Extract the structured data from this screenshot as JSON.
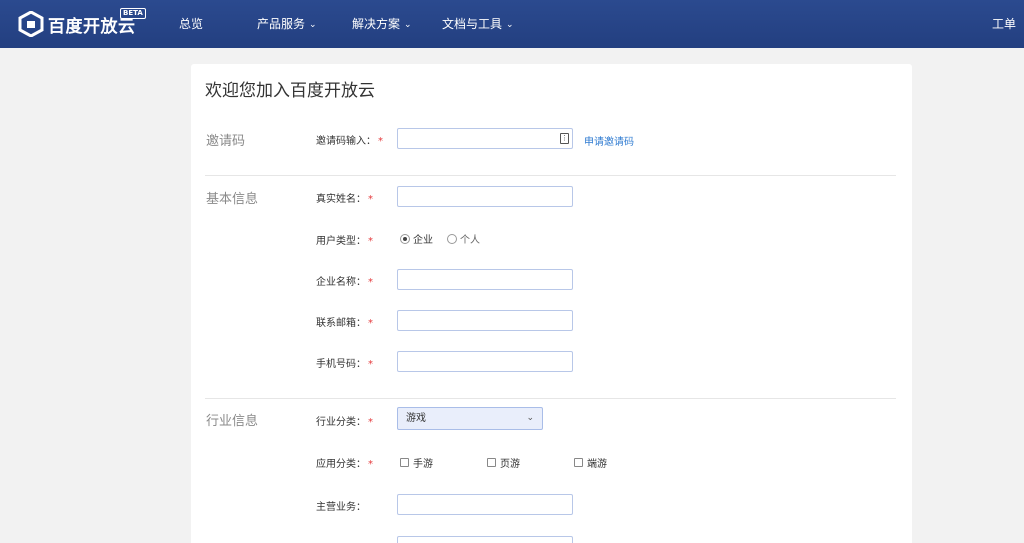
{
  "nav": {
    "logo_text": "百度开放云",
    "logo_badge": "BETA",
    "items": [
      {
        "label": "总览"
      },
      {
        "label": "产品服务"
      },
      {
        "label": "解决方案"
      },
      {
        "label": "文档与工具"
      }
    ],
    "ticket_label": "工单"
  },
  "form": {
    "title": "欢迎您加入百度开放云",
    "sections": {
      "invite": "邀请码",
      "basic": "基本信息",
      "industry": "行业信息"
    },
    "fields": {
      "invite_code": "邀请码输入：",
      "real_name": "真实姓名：",
      "user_type": "用户类型：",
      "company_name": "企业名称：",
      "email": "联系邮箱：",
      "phone": "手机号码：",
      "industry_category": "行业分类：",
      "app_category": "应用分类：",
      "main_business": "主营业务："
    },
    "apply_invite_link": "申请邀请码",
    "user_type_options": [
      "企业",
      "个人"
    ],
    "user_type_selected": "企业",
    "industry_selected": "游戏",
    "app_category_options": [
      "手游",
      "页游",
      "端游"
    ],
    "required_mark": "*"
  },
  "colors": {
    "nav_bg": "#233f80",
    "link": "#2f7bd1",
    "required": "#e4393c"
  }
}
